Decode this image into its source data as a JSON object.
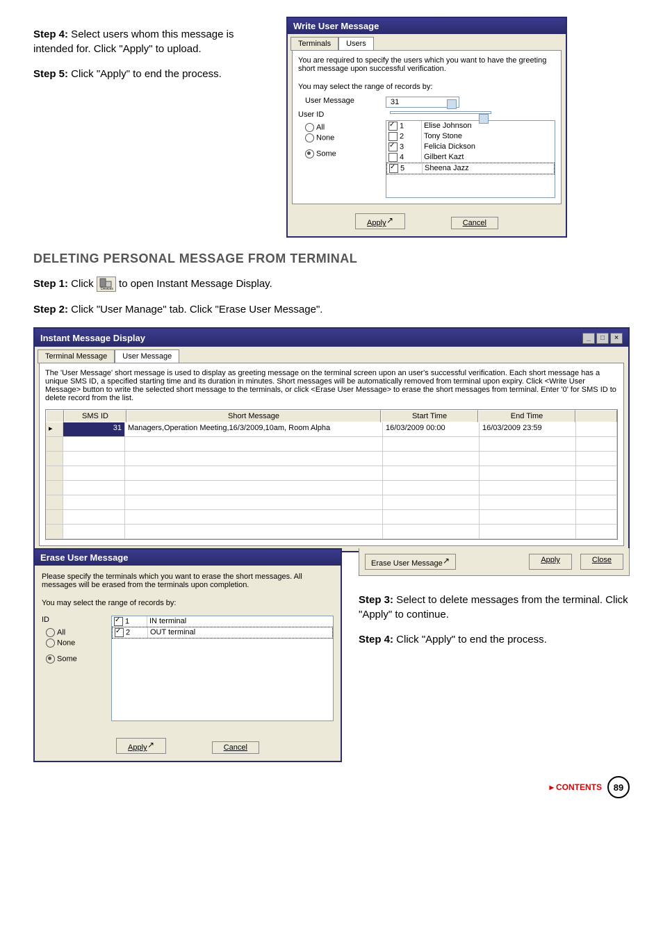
{
  "steps_top": {
    "s4_label": "Step 4:",
    "s4_text": " Select users whom this message is intended for. Click \"Apply\" to upload.",
    "s5_label": "Step 5:",
    "s5_text": " Click \"Apply\" to end the process."
  },
  "write_dialog": {
    "title": "Write User Message",
    "tabs": {
      "terminals": "Terminals",
      "users": "Users"
    },
    "intro": "You are required to specify the users which you want to have the greeting short message upon successful verification.",
    "range_label": "You may select the range of records by:",
    "user_message_label": "User Message",
    "user_message_value": "31",
    "user_id_label": "User ID",
    "opts": {
      "all": "All",
      "none": "None",
      "some": "Some"
    },
    "rows": [
      {
        "id": "1",
        "name": "Elise Johnson",
        "checked": true
      },
      {
        "id": "2",
        "name": "Tony Stone",
        "checked": false
      },
      {
        "id": "3",
        "name": "Felicia Dickson",
        "checked": true
      },
      {
        "id": "4",
        "name": "Gilbert Kazt",
        "checked": false
      },
      {
        "id": "5",
        "name": "Sheena Jazz",
        "checked": true
      }
    ],
    "apply": "Apply",
    "cancel": "Cancel"
  },
  "section_heading": "DELETING PERSONAL MESSAGE FROM TERMINAL",
  "step1": {
    "label": "Step 1:",
    "before": "  Click ",
    "after": " to open Instant Message Display."
  },
  "step2": {
    "label": "Step 2:",
    "text": " Click \"User Manage\" tab. Click \"Erase User Message\"."
  },
  "imd": {
    "title": "Instant Message Display",
    "tabs": {
      "terminal": "Terminal Message",
      "user": "User Message"
    },
    "intro": "The 'User Message' short message is used to display as greeting message on the terminal screen upon an user's successful verification. Each short message has a unique SMS ID, a specified starting time and its duration in minutes. Short messages will be automatically removed from terminal upon expiry. Click <Write User Message> button to write the selected short message to the terminals, or click <Erase User Message> to erase the short messages from terminal. Enter '0' for SMS ID to delete record from the list.",
    "cols": {
      "smsid": "SMS ID",
      "short": "Short Message",
      "start": "Start Time",
      "end": "End Time"
    },
    "row": {
      "id": "31",
      "msg": "Managers,Operation Meeting,16/3/2009,10am, Room Alpha",
      "start": "16/03/2009 00:00",
      "end": "16/03/2009 23:59"
    },
    "erase_btn": "Erase User Message",
    "apply": "Apply",
    "close": "Close"
  },
  "erase": {
    "title": "Erase User Message",
    "intro": "Please specify the terminals which you want to erase the short messages. All messages will be erased from the terminals upon completion.",
    "range_label": "You may select the range of records by:",
    "id_label": "ID",
    "opts": {
      "all": "All",
      "none": "None",
      "some": "Some"
    },
    "rows": [
      {
        "id": "1",
        "name": "IN terminal",
        "checked": true
      },
      {
        "id": "2",
        "name": "OUT terminal",
        "checked": true
      }
    ],
    "apply": "Apply",
    "cancel": "Cancel"
  },
  "steps_bottom": {
    "s3_label": "Step 3:",
    "s3_text": " Select to delete messages from the terminal. Click \"Apply\" to continue.",
    "s4_label": "Step 4:",
    "s4_text": " Click \"Apply\" to end the process."
  },
  "footer": {
    "contents": "CONTENTS",
    "page": "89"
  }
}
